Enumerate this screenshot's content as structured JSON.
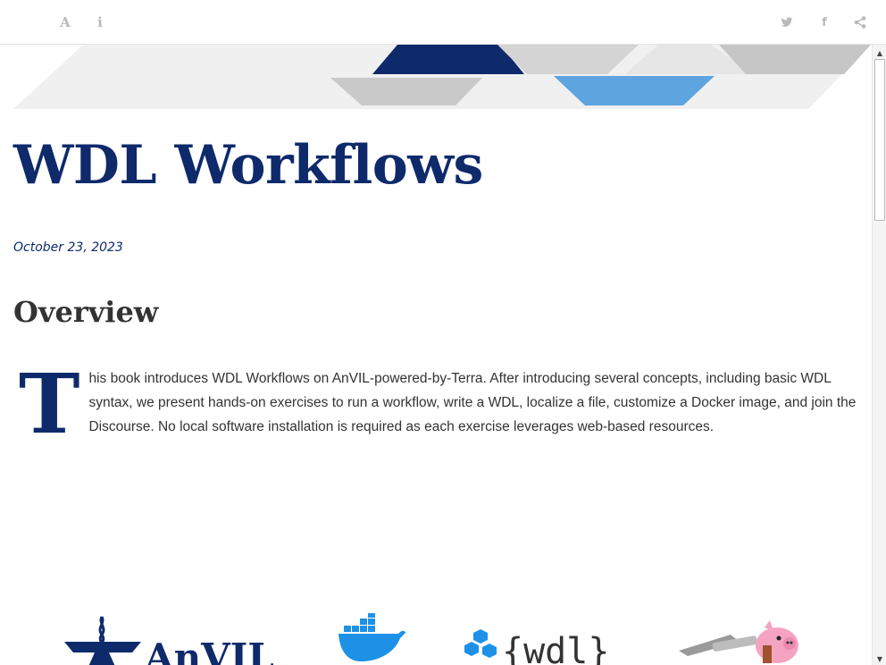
{
  "toolbar": {
    "font_glyph": "A",
    "info_glyph": "i",
    "twitter_glyph": "🐦",
    "facebook_glyph": "f",
    "share_glyph": "⋖"
  },
  "scrollbar": {
    "up_glyph": "▲",
    "down_glyph": "▼"
  },
  "page": {
    "title": "WDL Workflows",
    "date": "October 23, 2023",
    "section_heading": "Overview",
    "dropcap": "T",
    "intro": "his book introduces WDL Workflows on AnVIL-powered-by-Terra. After introducing several concepts, including basic WDL syntax, we present hands-on exercises to run a workflow, write a WDL, localize a file, customize a Docker image, and join the Discourse. No local software installation is required as each exercise leverages web-based resources."
  },
  "logos": {
    "anvil_text": "AnVIL",
    "wdl_text": "{wdl}"
  },
  "colors": {
    "navy": "#0e2a6b",
    "light_blue": "#5ea5e0",
    "grey": "#c8c8c8",
    "text": "#333333",
    "icon_grey": "#b9b9b9"
  },
  "icons": [
    "font-icon",
    "info-icon",
    "twitter-icon",
    "facebook-icon",
    "share-icon"
  ]
}
